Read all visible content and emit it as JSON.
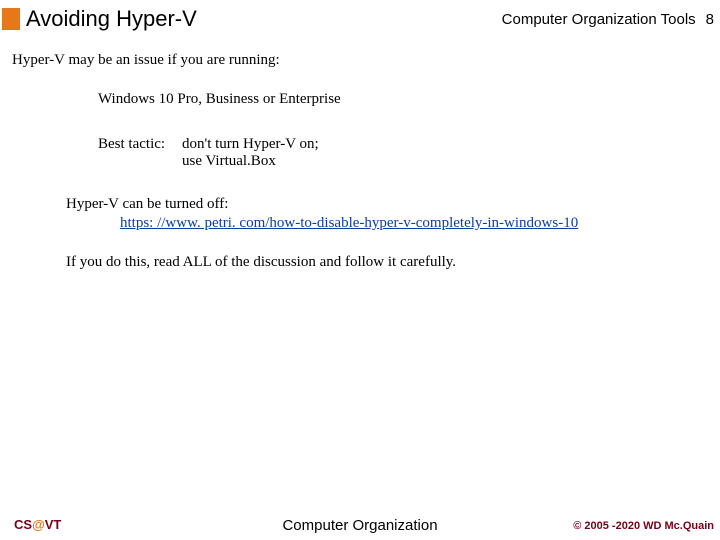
{
  "header": {
    "title": "Avoiding Hyper-V",
    "course": "Computer Organization Tools",
    "page_number": "8"
  },
  "content": {
    "intro": "Hyper-V may be an issue if you are running:",
    "windows_line": "Windows 10 Pro, Business or Enterprise",
    "tactic_label": "Best tactic:",
    "tactic_line1": "don't turn Hyper-V on;",
    "tactic_line2": "use Virtual.Box",
    "off_line": "Hyper-V can be turned off:",
    "link_text": "https: //www. petri. com/how-to-disable-hyper-v-completely-in-windows-10",
    "careful_line": "If you do this, read ALL of the discussion and follow it carefully."
  },
  "footer": {
    "left_prefix": "CS",
    "left_at": "@",
    "left_suffix": "VT",
    "center": "Computer Organization",
    "right": "© 2005 -2020 WD Mc.Quain"
  }
}
